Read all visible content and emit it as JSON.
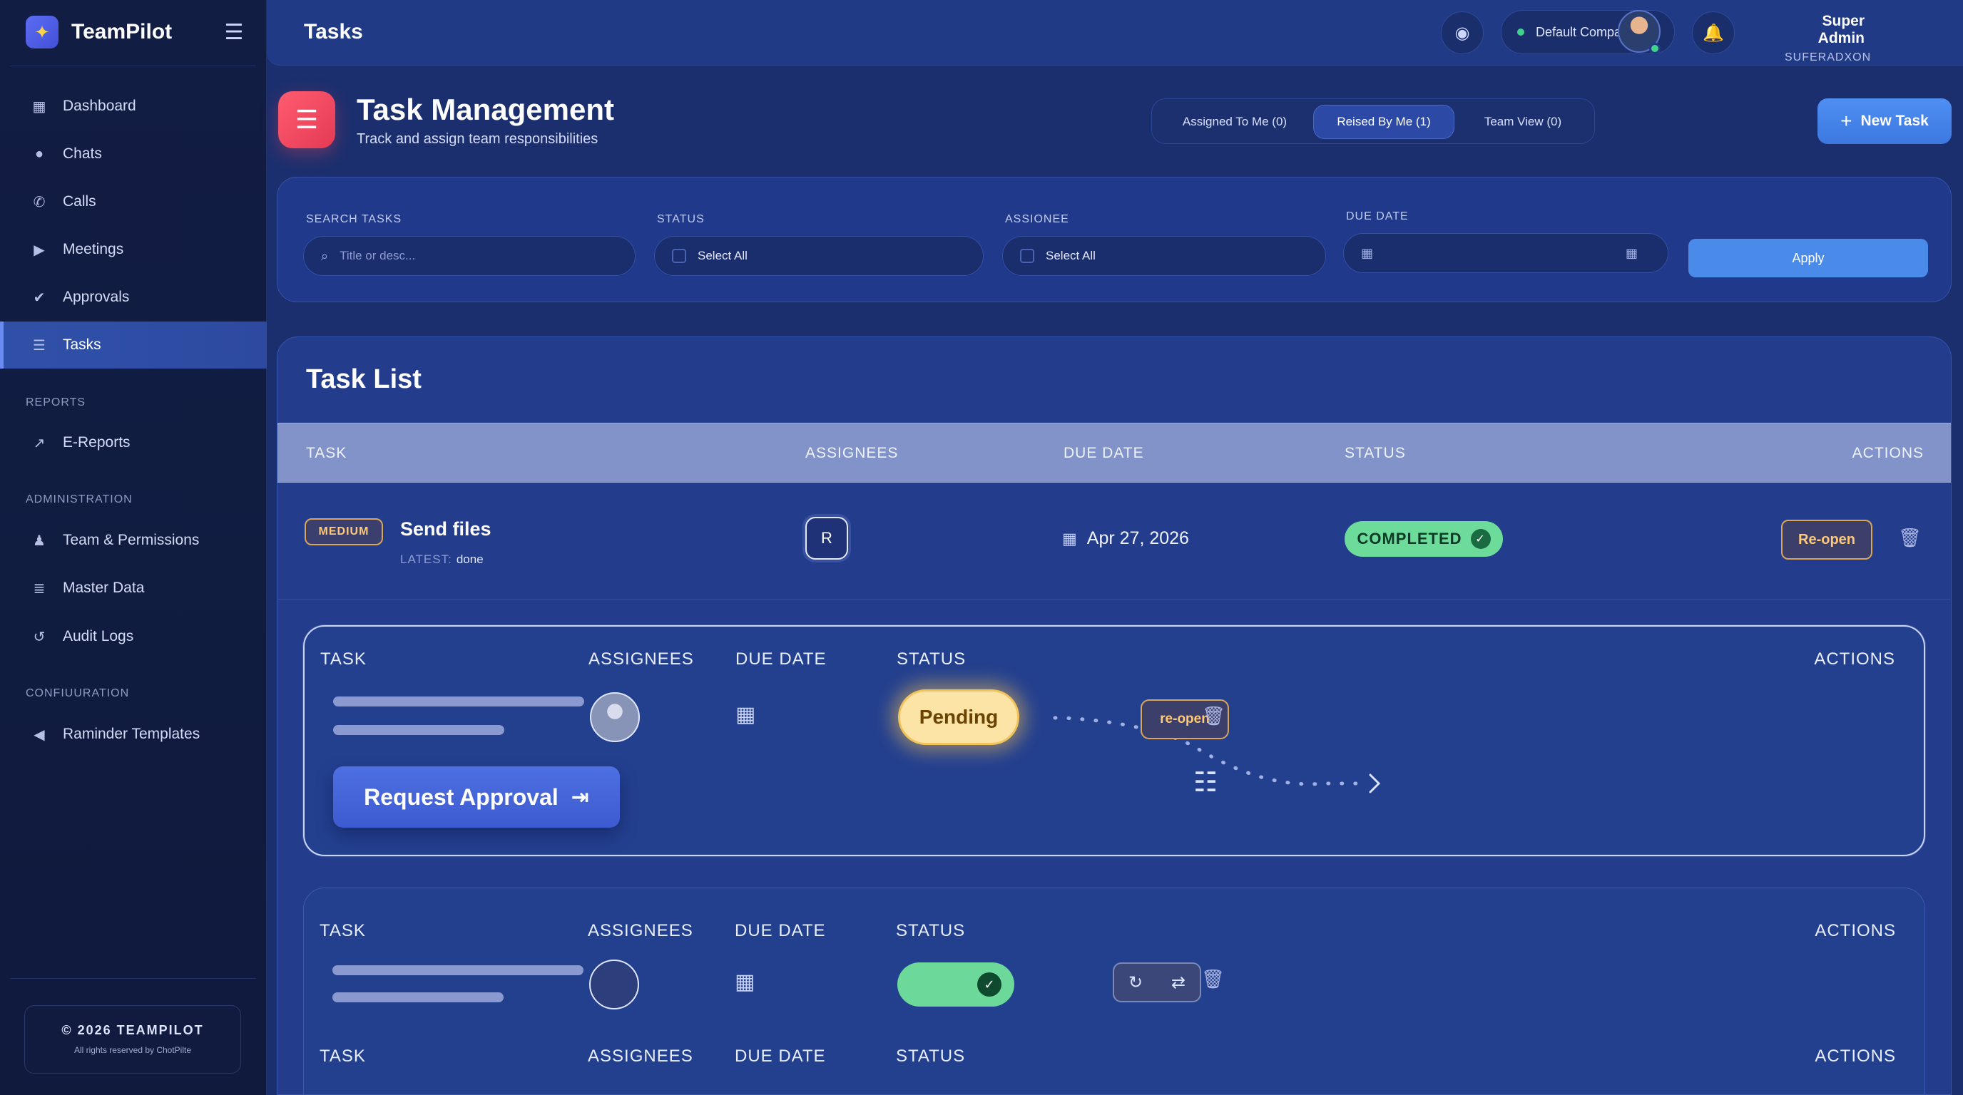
{
  "app": {
    "name": "TeamPilot"
  },
  "sidebar": {
    "items": [
      {
        "label": "Dashboard",
        "icon": "grid-icon",
        "glyph": "▦"
      },
      {
        "label": "Chats",
        "icon": "chat-icon",
        "glyph": "💬"
      },
      {
        "label": "Calls",
        "icon": "phone-icon",
        "glyph": "✆"
      },
      {
        "label": "Meetings",
        "icon": "video-icon",
        "glyph": "▶"
      },
      {
        "label": "Approvals",
        "icon": "check-icon",
        "glyph": "✔"
      },
      {
        "label": "Tasks",
        "icon": "list-icon",
        "glyph": "☰",
        "active": true
      }
    ],
    "reports_label": "REPORTS",
    "reports_items": [
      {
        "label": "E-Reports",
        "icon": "chart-icon",
        "glyph": "📈"
      }
    ],
    "admin_label": "ADMINISTRATION",
    "admin_items": [
      {
        "label": "Team & Permissions",
        "icon": "users-icon",
        "glyph": "👥"
      },
      {
        "label": "Master Data",
        "icon": "database-icon",
        "glyph": "🗄"
      },
      {
        "label": "Audit Logs",
        "icon": "history-icon",
        "glyph": "↺"
      }
    ],
    "config_label": "CONFIUURATION",
    "config_items": [
      {
        "label": "Raminder Templates",
        "icon": "megaphone-icon",
        "glyph": "📢"
      }
    ],
    "footer": {
      "copyright": "© 2026 TEAMPILOT",
      "rights": "All rights reserved by ChotPilte"
    }
  },
  "topbar": {
    "title": "Tasks",
    "company": "Default Company",
    "user_name": "Super Admin",
    "user_role": "SUFERADXON"
  },
  "header": {
    "title": "Task Management",
    "subtitle": "Track and assign team responsibilities",
    "tabs": [
      {
        "label": "Assigned To Me (0)"
      },
      {
        "label": "Reised By Me (1)",
        "active": true
      },
      {
        "label": "Team View (0)"
      }
    ],
    "new_task": "New Task"
  },
  "filters": {
    "search_label": "SEARCH TASKS",
    "search_placeholder": "Title or desc...",
    "status_label": "STATUS",
    "status_value": "Select All",
    "assignee_label": "ASSIONEE",
    "assignee_value": "Select All",
    "due_label": "DUE DATE",
    "apply": "Apply"
  },
  "task_list": {
    "title": "Task List",
    "columns": {
      "task": "TASK",
      "assignees": "ASSIGNEES",
      "due": "DUE DATE",
      "status": "STATUS",
      "actions": "ACTIONS"
    },
    "rows": [
      {
        "priority": "MEDIUM",
        "name": "Send files",
        "latest_label": "LATEST:",
        "latest_value": "done",
        "assignee": "R",
        "due": "Apr 27, 2026",
        "status": "COMPLETED",
        "action": "Re-open"
      }
    ]
  },
  "skeleton": {
    "columns": {
      "task": "TASK",
      "assignees": "ASSIGNEES",
      "due": "DUE DATE",
      "status": "STATUS",
      "actions": "ACTIONS"
    },
    "pending": "Pending",
    "reopen": "re-open",
    "request_approval": "Request Approval"
  },
  "colors": {
    "accent": "#4a8be9",
    "completed": "#6ddc9a",
    "pending": "#fbe4a6",
    "priority_medium": "#d9a55a",
    "header_icon": "#ff5c70"
  }
}
